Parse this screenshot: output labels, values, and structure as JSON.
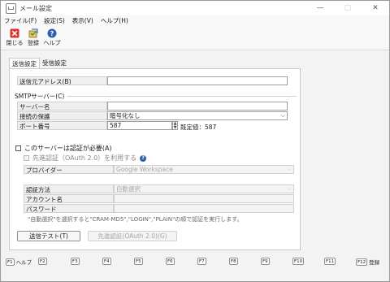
{
  "window": {
    "title": "メール設定",
    "minimize": "—",
    "maximize": "▢",
    "close": "✕"
  },
  "menu": [
    "ファイル(F)",
    "設定(S)",
    "表示(V)",
    "ヘルプ(H)"
  ],
  "toolbar": {
    "close_label": "閉じる",
    "register_label": "登録",
    "help_label": "ヘルプ"
  },
  "tabs": {
    "send": "送信設定",
    "receive": "受信設定"
  },
  "send": {
    "from_label": "送信元アドレス(B)",
    "from_value": "",
    "smtp_section": "SMTPサーバー(C)",
    "server_label": "サーバー名",
    "server_value": "",
    "conn_label": "接続の保護",
    "conn_value": "暗号化なし",
    "port_label": "ポート番号",
    "port_value": "587",
    "port_default": "既定値：587",
    "auth_required": "このサーバーは認証が必要(A)",
    "oauth_first": "先進認証（OAuth 2.0）を利用する",
    "provider_label": "プロバイダー",
    "provider_value": "Google Workspace",
    "auth_method_label": "認証方法",
    "auth_method_value": "自動選択",
    "account_label": "アカウント名",
    "account_value": "",
    "password_label": "パスワード",
    "password_value": "",
    "note": "\"自動選択\"を選択すると\"CRAM-MD5\",\"LOGIN\",\"PLAIN\"の順で認証を実行します。",
    "test_button": "送信テスト(T)",
    "oauth_button": "先進認証(OAuth 2.0)(G)"
  },
  "fkeys": [
    {
      "key": "F1",
      "label": "ヘルプ"
    },
    {
      "key": "F2",
      "label": ""
    },
    {
      "key": "F3",
      "label": ""
    },
    {
      "key": "F4",
      "label": ""
    },
    {
      "key": "F5",
      "label": ""
    },
    {
      "key": "F6",
      "label": ""
    },
    {
      "key": "F7",
      "label": ""
    },
    {
      "key": "F8",
      "label": ""
    },
    {
      "key": "F9",
      "label": ""
    },
    {
      "key": "F10",
      "label": ""
    },
    {
      "key": "F11",
      "label": ""
    },
    {
      "key": "F12",
      "label": "登録"
    }
  ],
  "colors": {
    "window_bg": "#f3f3f3",
    "panel_bg": "#ffffff",
    "help_icon": "#2d5fb0",
    "close_icon": "#d9342b"
  }
}
